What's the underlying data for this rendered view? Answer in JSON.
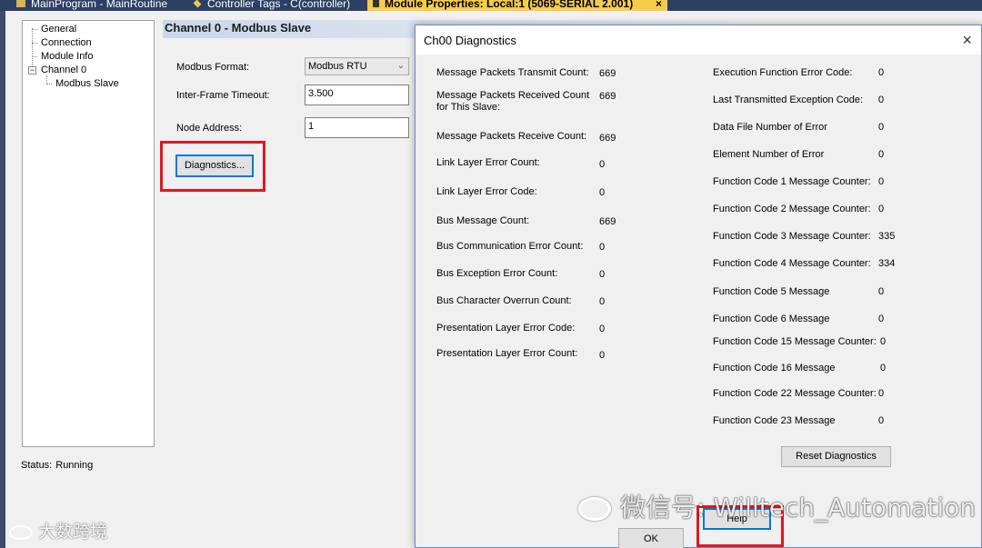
{
  "tabs": [
    {
      "label": "MainProgram - MainRoutine",
      "active": false
    },
    {
      "label": "Controller Tags - C(controller)",
      "active": false
    },
    {
      "label": "Module Properties: Local:1 (5069-SERIAL 2.001)",
      "active": true
    }
  ],
  "tab_close": "×",
  "tree": {
    "items": [
      "General",
      "Connection",
      "Module Info",
      "Channel 0",
      "Modbus Slave"
    ],
    "collapse_glyph": "−"
  },
  "status": {
    "label": "Status:",
    "value": "Running"
  },
  "section_title": "Channel 0 - Modbus Slave",
  "form": {
    "modbus_format_label": "Modbus Format:",
    "modbus_format_value": "Modbus RTU",
    "inter_frame_label": "Inter-Frame Timeout:",
    "inter_frame_value": "3.500",
    "node_address_label": "Node Address:",
    "node_address_value": "1",
    "diagnostics_button": "Diagnostics..."
  },
  "dialog": {
    "title": "Ch00 Diagnostics",
    "close_glyph": "×",
    "left_rows": [
      {
        "label": "Message Packets Transmit Count:",
        "value": "669"
      },
      {
        "label": "Message Packets Received Count for This Slave:",
        "value": "669"
      },
      {
        "label": "Message Packets Receive Count:",
        "value": "669"
      },
      {
        "label": "Link Layer Error Count:",
        "value": "0"
      },
      {
        "label": "Link Layer Error Code:",
        "value": "0"
      },
      {
        "label": "Bus Message Count:",
        "value": "669"
      },
      {
        "label": "Bus Communication Error Count:",
        "value": "0"
      },
      {
        "label": "Bus Exception Error Count:",
        "value": "0"
      },
      {
        "label": "Bus Character Overrun Count:",
        "value": "0"
      },
      {
        "label": "Presentation Layer Error Code:",
        "value": "0"
      },
      {
        "label": "Presentation Layer Error Count:",
        "value": "0"
      }
    ],
    "right_rows": [
      {
        "label": "Executiоn Function Error Code:",
        "value": "0"
      },
      {
        "label": "Last Transmitted Exception Code:",
        "value": "0"
      },
      {
        "label": "Data File Number of Error",
        "value": "0"
      },
      {
        "label": "Element Number of Error",
        "value": "0"
      },
      {
        "label": "Function Code 1 Message Counter:",
        "value": "0"
      },
      {
        "label": "Function Code 2 Message Counter:",
        "value": "0"
      },
      {
        "label": "Function Code 3 Message Counter:",
        "value": "335"
      },
      {
        "label": "Function Code 4 Message Counter:",
        "value": "334"
      },
      {
        "label": "Function Code 5 Message",
        "value": "0"
      },
      {
        "label": "Function Code 6 Message",
        "value": "0"
      },
      {
        "label": "Function Code 15 Message Counter:",
        "value": "0"
      },
      {
        "label": "Function Code 16 Message",
        "value": "0"
      },
      {
        "label": "Function Code 22 Message Counter:",
        "value": "0"
      },
      {
        "label": "Function Code 23 Message",
        "value": "0"
      }
    ],
    "reset_button": "Reset Diagnostics",
    "ok_button": "OK",
    "help_button": "Help"
  },
  "watermark": {
    "text": "微信号: Willtech_Automation",
    "corner_text": "大数跨境"
  },
  "colors": {
    "highlight_red": "#e3161c",
    "tab_active": "#f5cc4c",
    "focus_blue": "#0078d7"
  }
}
